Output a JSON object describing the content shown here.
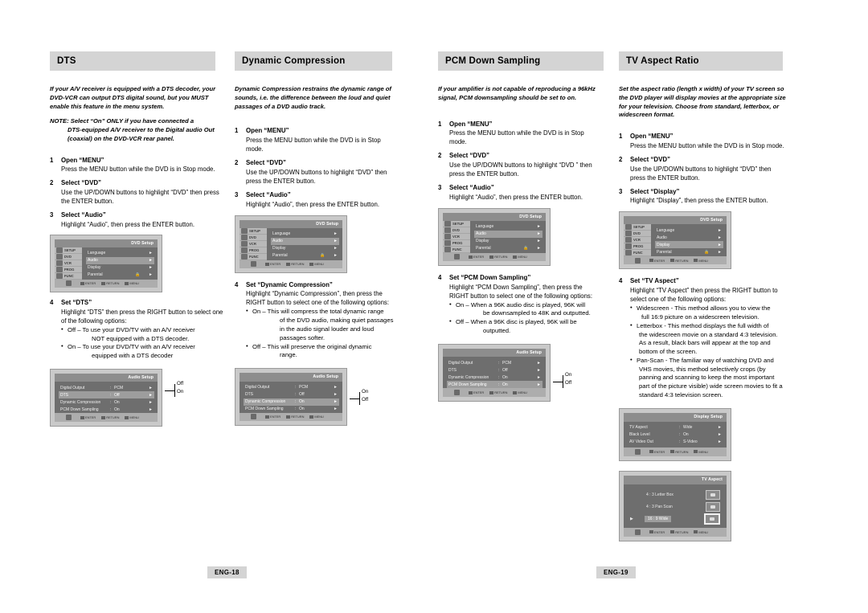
{
  "document": {
    "type": "dvd-vcr-user-manual-page",
    "page_labels": {
      "left": "ENG-18",
      "right": "ENG-19"
    }
  },
  "columns": [
    {
      "id": "dts",
      "header": "DTS",
      "intro": "If your A/V receiver is equipped with a DTS decoder, your DVD-VCR can output DTS digital sound, but you MUST enable this feature in the menu system.",
      "note_label": "NOTE:",
      "note_text": "Select “On” ONLY if you have connected a",
      "note_text2": "DTS-equipped A/V receiver to the Digital audio Out (coaxial) on the DVD-VCR rear panel.",
      "steps": [
        {
          "num": "1",
          "title": "Open “MENU”",
          "body": "Press the MENU button while the DVD is in Stop mode."
        },
        {
          "num": "2",
          "title": "Select “DVD”",
          "body": "Use the UP/DOWN buttons to highlight “DVD” then press the ENTER button."
        },
        {
          "num": "3",
          "title": "Select “Audio”",
          "body": "Highlight “Audio”, then press the ENTER button."
        }
      ],
      "step4": {
        "num": "4",
        "title": "Set “DTS”",
        "body": "Highlight  “DTS”  then press the RIGHT button to select one of the following options:",
        "bullets": [
          {
            "dot": "•",
            "lead": "Off –",
            "text": "To use your DVD/TV with an A/V receiver",
            "cont": "NOT equipped with a DTS decoder."
          },
          {
            "dot": "•",
            "lead": "On –",
            "text": "To use your DVD/TV with an A/V receiver",
            "cont": "equipped with a DTS decoder"
          }
        ]
      }
    },
    {
      "id": "dynamic-compression",
      "header": "Dynamic Compression",
      "intro": "Dynamic Compression restrains the dynamic range of sounds, i.e. the difference between the loud and quiet passages of a DVD audio track.",
      "steps": [
        {
          "num": "1",
          "title": "Open “MENU”",
          "body": "Press the MENU button while the DVD is in Stop mode."
        },
        {
          "num": "2",
          "title": "Select “DVD”",
          "body": "Use the UP/DOWN buttons to highlight “DVD” then press the ENTER button."
        },
        {
          "num": "3",
          "title": "Select “Audio”",
          "body": "Highlight “Audio”, then press the ENTER button."
        }
      ],
      "step4": {
        "num": "4",
        "title": "Set “Dynamic Compression”",
        "body": "Highlight “Dynamic Compression”, then press the RIGHT button to select one of the following options:",
        "bullets": [
          {
            "dot": "•",
            "lead": "On –",
            "text": "This will compress the total dynamic range",
            "cont": "of the DVD audio, making quiet passages in the audio signal louder and loud passages softer."
          },
          {
            "dot": "•",
            "lead": "Off –",
            "text": "This will preserve the original dynamic",
            "cont": "range."
          }
        ]
      }
    },
    {
      "id": "pcm-down-sampling",
      "header": "PCM Down Sampling",
      "intro": "If your amplifier is not capable of reproducing a 96kHz signal, PCM downsampling should be set to on.",
      "steps": [
        {
          "num": "1",
          "title": "Open “MENU”",
          "body": "Press the MENU button while the DVD is in Stop mode."
        },
        {
          "num": "2",
          "title": "Select “DVD”",
          "body": "Use the UP/DOWN buttons to highlight “DVD ” then press the ENTER button."
        },
        {
          "num": "3",
          "title": "Select “Audio”",
          "body": "Highlight “Audio”, then press the ENTER button."
        }
      ],
      "step4": {
        "num": "4",
        "title": "Set “PCM Down Sampling”",
        "body": "Highlight “PCM Down Sampling”, then press the RIGHT button to select one of the following options:",
        "bullets": [
          {
            "dot": "•",
            "lead": "On –",
            "text": "When a 96K audio disc is played, 96K will",
            "cont": "be downsampled to 48K and outputted."
          },
          {
            "dot": "•",
            "lead": "Off –",
            "text": "When a 96K disc is played, 96K will be",
            "cont": "outputted."
          }
        ]
      }
    },
    {
      "id": "tv-aspect-ratio",
      "header": "TV Aspect Ratio",
      "intro": "Set the aspect ratio (length x width) of your TV screen so the DVD player will display movies at the appropriate size for your television. Choose from standard, letterbox, or widescreen format.",
      "steps": [
        {
          "num": "1",
          "title": "Open “MENU”",
          "body": "Press the MENU button while the DVD is in Stop mode."
        },
        {
          "num": "2",
          "title": "Select “DVD”",
          "body": "Use the UP/DOWN buttons to highlight “DVD” then press the ENTER button."
        },
        {
          "num": "3",
          "title": "Select “Display”",
          "body": "Highlight “Display”, then press the ENTER button."
        }
      ],
      "step4": {
        "num": "4",
        "title": "Set “TV Aspect”",
        "body": "Highlight “TV Aspect” then press the RIGHT button to select one of the following options:",
        "bullets": [
          {
            "dot": "•",
            "lead": "",
            "text": "Widescreen - This method allows you to view the",
            "cont": "full 16:9 picture on a widescreen television."
          },
          {
            "dot": "•",
            "lead": "",
            "text": "Letterbox - This method displays the full width of",
            "cont": "the widescreen movie on a standard 4:3 television. As a result, black bars will appear at the top and bottom of the screen."
          },
          {
            "dot": "•",
            "lead": "",
            "text": "Pan-Scan - The familiar way of watching DVD and",
            "cont": "VHS movies, this method selectively crops (by panning and scanning to keep the most important part of the picture visible) wide screen movies to fit a standard 4:3 television screen."
          }
        ]
      }
    }
  ],
  "menus": {
    "dvd_setup": {
      "title": "DVD Setup",
      "sidebar": [
        "SETUP",
        "DVD",
        "VCR",
        "PROG",
        "FUNC"
      ],
      "rows": [
        {
          "name": "Language",
          "value": "",
          "arrow": "►",
          "selected": false
        },
        {
          "name": "Audio",
          "value": "",
          "arrow": "►",
          "selected": true
        },
        {
          "name": "Display",
          "value": "",
          "arrow": "►",
          "selected": false
        },
        {
          "name": "Parental",
          "value": "",
          "arrow": "►",
          "selected": false
        }
      ],
      "footer": [
        "ENTER",
        "RETURN",
        "MENU"
      ]
    },
    "audio_setup": {
      "title": "Audio Setup",
      "rows": [
        {
          "name": "Digital Output",
          "colon": ":",
          "value": "PCM",
          "arrow": "►",
          "selected": false
        },
        {
          "name": "DTS",
          "colon": ":",
          "value": "Off",
          "arrow": "►",
          "selected": false
        },
        {
          "name": "Dynamic Compression",
          "colon": ":",
          "value": "On",
          "arrow": "►",
          "selected": false
        },
        {
          "name": "PCM Down Sampling",
          "colon": ":",
          "value": "On",
          "arrow": "►",
          "selected": false
        }
      ],
      "footer": [
        "ENTER",
        "RETURN",
        "MENU"
      ]
    },
    "display_setup": {
      "title": "Display Setup",
      "rows": [
        {
          "name": "TV Aspect",
          "colon": ":",
          "value": "Wide",
          "arrow": "►",
          "selected": false
        },
        {
          "name": "Black Level",
          "colon": ":",
          "value": "On",
          "arrow": "►",
          "selected": false
        },
        {
          "name": "AV Video Out",
          "colon": ":",
          "value": "S-Video",
          "arrow": "►",
          "selected": false
        }
      ],
      "footer": [
        "ENTER",
        "RETURN",
        "MENU"
      ]
    },
    "tv_aspect": {
      "title": "TV Aspect",
      "options": [
        {
          "label": "4 : 3  Letter Box",
          "selected": false
        },
        {
          "label": "4 : 3 Pan Scan",
          "selected": false
        },
        {
          "label": "16 : 9 Wide",
          "selected": true
        }
      ],
      "footer": [
        "ENTER",
        "RETURN",
        "MENU"
      ]
    }
  },
  "callouts": {
    "dts": {
      "top": "Off",
      "bottom": "On"
    },
    "dynamic": {
      "top": "On",
      "bottom": "Off"
    },
    "pcm": {
      "top": "On",
      "bottom": "Off"
    }
  },
  "colors": {
    "header_bg": "#d4d4d4",
    "tv_screen": "#6e6e6e",
    "tv_sidebar": "#b9b9b9",
    "tv_selected": "#9d9d9d"
  }
}
